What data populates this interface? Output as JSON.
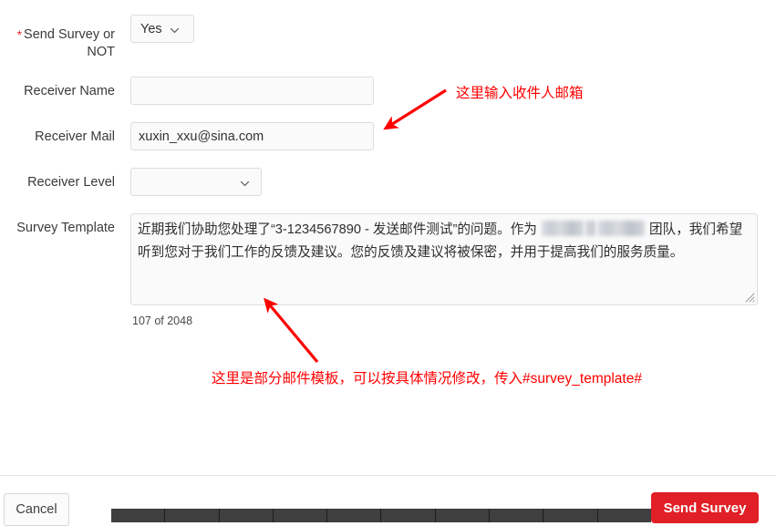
{
  "form": {
    "rows": [
      {
        "label": "Send Survey or NOT",
        "required": true,
        "control": "select",
        "value": "Yes"
      },
      {
        "label": "Receiver Name",
        "required": false,
        "control": "text",
        "value": "",
        "placeholder": ""
      },
      {
        "label": "Receiver Mail",
        "required": false,
        "control": "text",
        "value": "xuxin_xxu@sina.com",
        "placeholder": ""
      },
      {
        "label": "Receiver Level",
        "required": false,
        "control": "select",
        "value": ""
      },
      {
        "label": "Survey Template",
        "required": false,
        "control": "textarea"
      }
    ],
    "required_marker": "*",
    "survey_template": {
      "part1": "近期我们协助您处理了“3-1234567890 - 发送邮件测试”的问题。作为 ",
      "part2": " 团队，我们希望听到您对于我们工作的反馈及建议。您的反馈及建议将被保密，并用于提高我们的服务质量。",
      "char_counter": "107 of 2048"
    }
  },
  "annotations": [
    {
      "id": "annot-mail",
      "text": "这里输入收件人邮箱"
    },
    {
      "id": "annot-template",
      "text": "这里是部分邮件模板，可以按具体情况修改，传入#survey_template#"
    }
  ],
  "footer": {
    "cancel_label": "Cancel",
    "send_label": "Send Survey"
  },
  "colors": {
    "annotation_red": "#ff0000",
    "primary_red": "#e11f26",
    "required_red": "#e03131",
    "field_bg": "#fafafa",
    "field_border": "#dddddd",
    "taskbar": "#3f3f3f"
  }
}
